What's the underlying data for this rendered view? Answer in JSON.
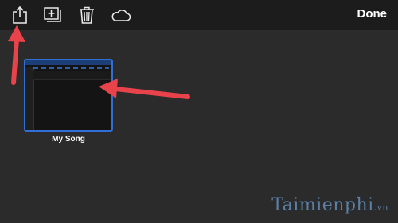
{
  "toolbar": {
    "share_icon": "share-icon",
    "new_project_icon": "add-project-icon",
    "trash_icon": "trash-icon",
    "cloud_icon": "cloud-icon",
    "done_label": "Done"
  },
  "project": {
    "name": "My Song"
  },
  "watermark": {
    "text": "Taimienphi",
    "suffix": ".vn"
  },
  "colors": {
    "background": "#2b2b2b",
    "toolbar": "#1c1c1c",
    "accent": "#2f6fd6",
    "annotation_arrow": "#e8434a"
  }
}
